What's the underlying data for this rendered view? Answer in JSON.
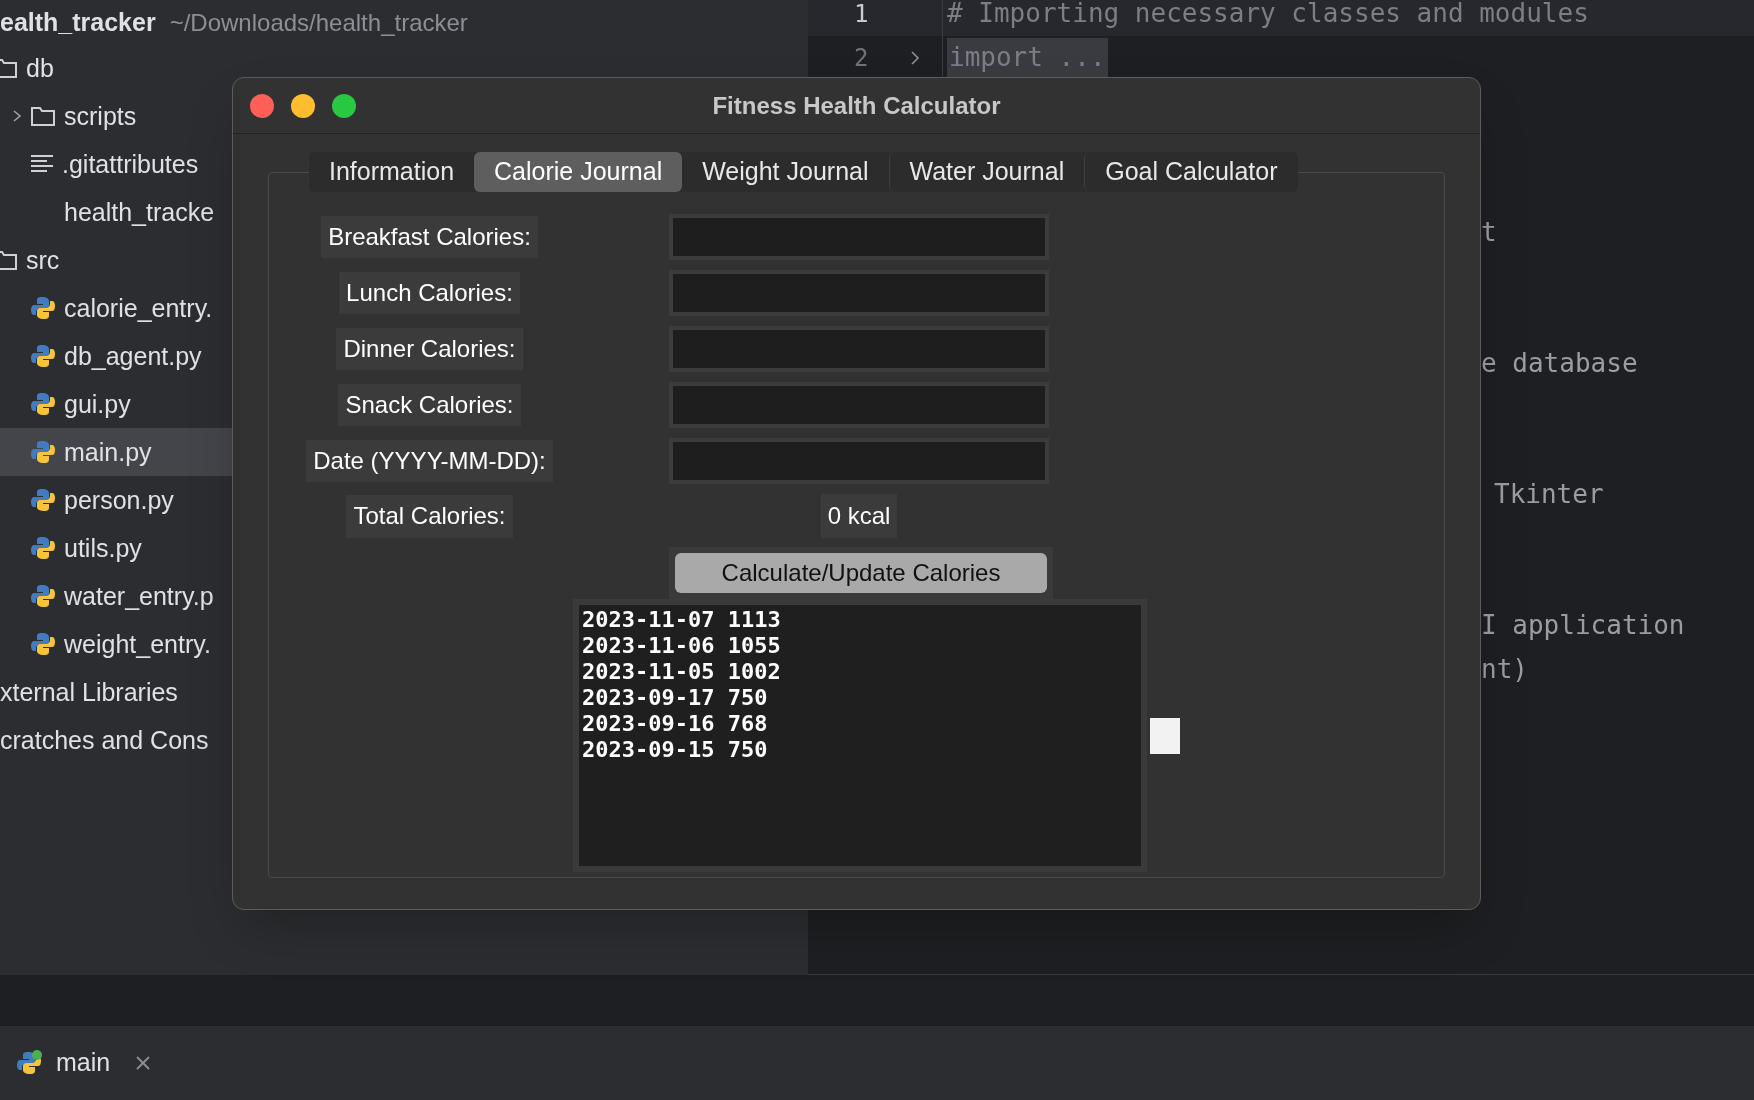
{
  "project": {
    "name": "ealth_tracker",
    "path": "~/Downloads/health_tracker"
  },
  "tree": [
    {
      "label": "db",
      "kind": "folder",
      "selected": false,
      "children": [
        {
          "label": "scripts",
          "kind": "folder",
          "expanded": false,
          "selected": false
        },
        {
          "label": ".gitattributes",
          "kind": "text",
          "selected": false
        },
        {
          "label": "health_tracke",
          "kind": "plain",
          "selected": false
        }
      ]
    },
    {
      "label": "src",
      "kind": "folder",
      "selected": false,
      "children": [
        {
          "label": "calorie_entry.",
          "kind": "python",
          "selected": false
        },
        {
          "label": "db_agent.py",
          "kind": "python",
          "selected": false
        },
        {
          "label": "gui.py",
          "kind": "python",
          "selected": false
        },
        {
          "label": "main.py",
          "kind": "python",
          "selected": true
        },
        {
          "label": "person.py",
          "kind": "python",
          "selected": false
        },
        {
          "label": "utils.py",
          "kind": "python",
          "selected": false
        },
        {
          "label": "water_entry.p",
          "kind": "python",
          "selected": false
        },
        {
          "label": "weight_entry.",
          "kind": "python",
          "selected": false
        }
      ]
    },
    {
      "label": "xternal Libraries",
      "kind": "root",
      "selected": false
    },
    {
      "label": "cratches and Cons",
      "kind": "root",
      "selected": false
    }
  ],
  "editor": {
    "lines": [
      {
        "number": "1",
        "text": "# Importing necessary classes and modules"
      },
      {
        "number": "2",
        "text": "import ...",
        "folded": true
      }
    ],
    "fragments": [
      "t",
      "e database",
      "Tkinter",
      "I application",
      "nt)"
    ]
  },
  "dialog": {
    "title": "Fitness Health Calculator",
    "tabs": [
      {
        "label": "Information",
        "selected": false
      },
      {
        "label": "Calorie Journal",
        "selected": true
      },
      {
        "label": "Weight Journal",
        "selected": false
      },
      {
        "label": "Water Journal",
        "selected": false
      },
      {
        "label": "Goal Calculator",
        "selected": false
      }
    ],
    "fields": [
      {
        "label": "Breakfast Calories:"
      },
      {
        "label": "Lunch Calories:"
      },
      {
        "label": "Dinner Calories:"
      },
      {
        "label": "Snack Calories:"
      },
      {
        "label": "Date (YYYY-MM-DD):"
      }
    ],
    "total": {
      "label": "Total Calories:",
      "value": "0 kcal"
    },
    "button": "Calculate/Update Calories",
    "history": [
      "2023-11-07 1113",
      "2023-11-06 1055",
      "2023-11-05 1002",
      "2023-09-17 750",
      "2023-09-16 768",
      "2023-09-15 750"
    ]
  },
  "run_tab": {
    "label": "main"
  }
}
